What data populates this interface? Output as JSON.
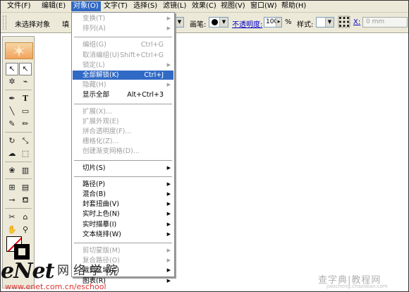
{
  "menubar": {
    "items": [
      {
        "label": "文件(F)"
      },
      {
        "label": "编辑(E)"
      },
      {
        "label": "对象(O)"
      },
      {
        "label": "文字(T)"
      },
      {
        "label": "选择(S)"
      },
      {
        "label": "滤镜(L)"
      },
      {
        "label": "效果(C)"
      },
      {
        "label": "视图(V)"
      },
      {
        "label": "窗口(W)"
      },
      {
        "label": "帮助(H)"
      }
    ],
    "active": "对象(O)"
  },
  "control_bar": {
    "selection_status": "未选择对象",
    "fill_label_partial": "填",
    "stroke_label": "画笔:",
    "opacity_label": "不透明度:",
    "opacity_value": "100",
    "opacity_unit": "%",
    "style_label": "样式:",
    "x_label": "X:",
    "x_value": "0 mm"
  },
  "object_menu": {
    "items": [
      {
        "label": "变换(T)",
        "shortcut": "",
        "submenu": true,
        "enabled": false
      },
      {
        "label": "排列(A)",
        "shortcut": "",
        "submenu": true,
        "enabled": false
      },
      {
        "separator": true
      },
      {
        "label": "编组(G)",
        "shortcut": "Ctrl+G",
        "submenu": false,
        "enabled": false
      },
      {
        "label": "取消编组(U)",
        "shortcut": "Shift+Ctrl+G",
        "submenu": false,
        "enabled": false
      },
      {
        "label": "锁定(L)",
        "shortcut": "",
        "submenu": true,
        "enabled": false
      },
      {
        "label": "全部解锁(K)",
        "shortcut": "Ctrl+J",
        "submenu": false,
        "enabled": true,
        "highlighted": true
      },
      {
        "label": "隐藏(H)",
        "shortcut": "",
        "submenu": true,
        "enabled": false
      },
      {
        "label": "显示全部",
        "shortcut": "Alt+Ctrl+3",
        "submenu": false,
        "enabled": true
      },
      {
        "separator": true
      },
      {
        "label": "扩展(X)...",
        "shortcut": "",
        "submenu": false,
        "enabled": false
      },
      {
        "label": "扩展外观(E)",
        "shortcut": "",
        "submenu": false,
        "enabled": false
      },
      {
        "label": "拼合透明度(F)...",
        "shortcut": "",
        "submenu": false,
        "enabled": false
      },
      {
        "label": "栅格化(Z)...",
        "shortcut": "",
        "submenu": false,
        "enabled": false
      },
      {
        "label": "创建渐变网格(D)...",
        "shortcut": "",
        "submenu": false,
        "enabled": false
      },
      {
        "separator": true
      },
      {
        "label": "切片(S)",
        "shortcut": "",
        "submenu": true,
        "enabled": true
      },
      {
        "separator": true
      },
      {
        "label": "路径(P)",
        "shortcut": "",
        "submenu": true,
        "enabled": true
      },
      {
        "label": "混合(B)",
        "shortcut": "",
        "submenu": true,
        "enabled": true
      },
      {
        "label": "封套扭曲(V)",
        "shortcut": "",
        "submenu": true,
        "enabled": true
      },
      {
        "label": "实时上色(N)",
        "shortcut": "",
        "submenu": true,
        "enabled": true
      },
      {
        "label": "实时描摹(I)",
        "shortcut": "",
        "submenu": true,
        "enabled": true
      },
      {
        "label": "文本绕排(W)",
        "shortcut": "",
        "submenu": true,
        "enabled": true
      },
      {
        "separator": true
      },
      {
        "label": "剪切蒙版(M)",
        "shortcut": "",
        "submenu": true,
        "enabled": false
      },
      {
        "label": "复合路径(O)",
        "shortcut": "",
        "submenu": true,
        "enabled": false
      },
      {
        "label": "裁剪区域(C)",
        "shortcut": "",
        "submenu": true,
        "enabled": true
      },
      {
        "label": "图表(R)",
        "shortcut": "",
        "submenu": true,
        "enabled": true
      }
    ]
  },
  "toolbox": {
    "tools": [
      {
        "icon": "selection-tool-icon",
        "glyph": "↖"
      },
      {
        "icon": "direct-selection-tool-icon",
        "glyph": "↖"
      },
      {
        "icon": "magic-wand-tool-icon",
        "glyph": "✲"
      },
      {
        "icon": "lasso-tool-icon",
        "glyph": "⌁"
      },
      {
        "icon": "pen-tool-icon",
        "glyph": "✒"
      },
      {
        "icon": "type-tool-icon",
        "glyph": "T"
      },
      {
        "icon": "line-tool-icon",
        "glyph": "╲"
      },
      {
        "icon": "rectangle-tool-icon",
        "glyph": "▭"
      },
      {
        "icon": "paintbrush-tool-icon",
        "glyph": "✎"
      },
      {
        "icon": "pencil-tool-icon",
        "glyph": "✏"
      },
      {
        "icon": "rotate-tool-icon",
        "glyph": "↻"
      },
      {
        "icon": "scale-tool-icon",
        "glyph": "⤡"
      },
      {
        "icon": "warp-tool-icon",
        "glyph": "☁"
      },
      {
        "icon": "free-transform-tool-icon",
        "glyph": "⬚"
      },
      {
        "icon": "symbol-sprayer-tool-icon",
        "glyph": "❀"
      },
      {
        "icon": "column-graph-tool-icon",
        "glyph": "▥"
      },
      {
        "icon": "mesh-tool-icon",
        "glyph": "⊞"
      },
      {
        "icon": "gradient-tool-icon",
        "glyph": "▤"
      },
      {
        "icon": "eyedropper-tool-icon",
        "glyph": "⊸"
      },
      {
        "icon": "live-paint-bucket-tool-icon",
        "glyph": "⛾"
      },
      {
        "icon": "scissors-tool-icon",
        "glyph": "✂"
      },
      {
        "icon": "slice-tool-icon",
        "glyph": "⌂"
      },
      {
        "icon": "hand-tool-icon",
        "glyph": "✋"
      },
      {
        "icon": "zoom-tool-icon",
        "glyph": "⚲"
      }
    ]
  },
  "watermarks": {
    "enet": "eNet",
    "enet_cn": "网络学院",
    "enet_url": "www.enet.com.cn/eschool",
    "jiaocheng": "查字典|教程网",
    "jiaocheng_url": "jiaocheng.chazidian.com"
  },
  "colors": {
    "menu_highlight": "#316ac5",
    "chrome": "#ece9d8",
    "disabled_text": "#a0a0a0",
    "opacity_link": "#0000cc"
  }
}
